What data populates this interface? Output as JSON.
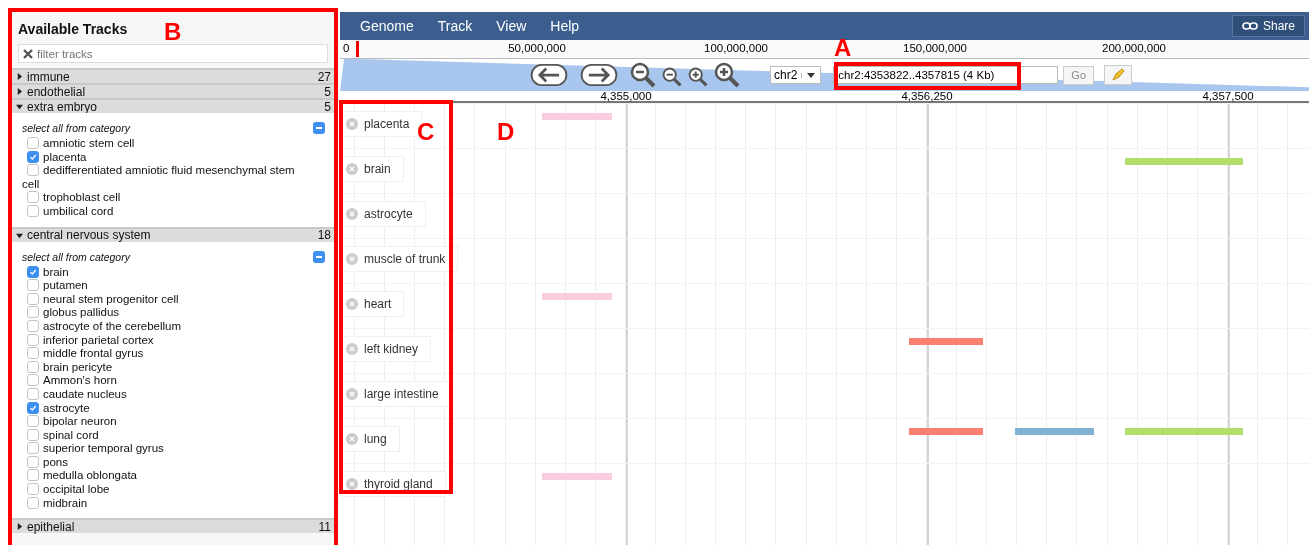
{
  "sidebar": {
    "title": "Available Tracks",
    "filter": {
      "placeholder": "filter tracks"
    },
    "categories": [
      {
        "name": "immune",
        "count": "27",
        "expanded": false
      },
      {
        "name": "endothelial",
        "count": "5",
        "expanded": false
      },
      {
        "name": "extra embryo",
        "count": "5",
        "expanded": true,
        "select_all": "select all from category",
        "items": [
          {
            "label": "amniotic stem cell",
            "checked": false
          },
          {
            "label": "placenta",
            "checked": true
          },
          {
            "label": "dedifferentiated amniotic fluid mesenchymal stem cell",
            "checked": false
          },
          {
            "label": "trophoblast cell",
            "checked": false
          },
          {
            "label": "umbilical cord",
            "checked": false
          }
        ]
      },
      {
        "name": "central nervous system",
        "count": "18",
        "expanded": true,
        "select_all": "select all from category",
        "items": [
          {
            "label": "brain",
            "checked": true
          },
          {
            "label": "putamen",
            "checked": false
          },
          {
            "label": "neural stem progenitor cell",
            "checked": false
          },
          {
            "label": "globus pallidus",
            "checked": false
          },
          {
            "label": "astrocyte of the cerebellum",
            "checked": false
          },
          {
            "label": "inferior parietal cortex",
            "checked": false
          },
          {
            "label": "middle frontal gyrus",
            "checked": false
          },
          {
            "label": "brain pericyte",
            "checked": false
          },
          {
            "label": "Ammon's horn",
            "checked": false
          },
          {
            "label": "caudate nucleus",
            "checked": false
          },
          {
            "label": "astrocyte",
            "checked": true
          },
          {
            "label": "bipolar neuron",
            "checked": false
          },
          {
            "label": "spinal cord",
            "checked": false
          },
          {
            "label": "superior temporal gyrus",
            "checked": false
          },
          {
            "label": "pons",
            "checked": false
          },
          {
            "label": "medulla oblongata",
            "checked": false
          },
          {
            "label": "occipital lobe",
            "checked": false
          },
          {
            "label": "midbrain",
            "checked": false
          }
        ]
      },
      {
        "name": "epithelial",
        "count": "11",
        "expanded": false
      }
    ]
  },
  "menu": [
    {
      "label": "Genome"
    },
    {
      "label": "Track"
    },
    {
      "label": "View"
    },
    {
      "label": "Help"
    }
  ],
  "share_button": "Share",
  "overview": {
    "ticks": [
      "0",
      "50,000,000",
      "100,000,000",
      "150,000,000",
      "200,000,000"
    ]
  },
  "navigation": {
    "chromosome": "chr2",
    "location": "chr2:4353822..4357815 (4 Kb)",
    "go_button": "Go"
  },
  "ruler": {
    "ticks": [
      "4,355,000",
      "4,356,250",
      "4,357,500"
    ]
  },
  "tracks": [
    {
      "name": "placenta",
      "features": [
        {
          "color": "#f9cce0"
        }
      ]
    },
    {
      "name": "brain",
      "features": [
        {
          "color": "#b3de69"
        }
      ]
    },
    {
      "name": "astrocyte"
    },
    {
      "name": "muscle of trunk"
    },
    {
      "name": "heart",
      "features": [
        {
          "color": "#f9cce0"
        }
      ]
    },
    {
      "name": "left kidney",
      "features": [
        {
          "color": "#fb8072"
        }
      ]
    },
    {
      "name": "large intestine"
    },
    {
      "name": "lung",
      "features": [
        {
          "color": "#fb8072"
        },
        {
          "color": "#80b1d3"
        },
        {
          "color": "#b3de69"
        }
      ]
    },
    {
      "name": "thyroid gland",
      "features": [
        {
          "color": "#f9cce0"
        }
      ]
    }
  ],
  "annotations": [
    {
      "letter": "A",
      "boxed": true
    },
    {
      "letter": "B",
      "boxed": true
    },
    {
      "letter": "C",
      "boxed": true
    },
    {
      "letter": "D",
      "boxed": false
    }
  ]
}
